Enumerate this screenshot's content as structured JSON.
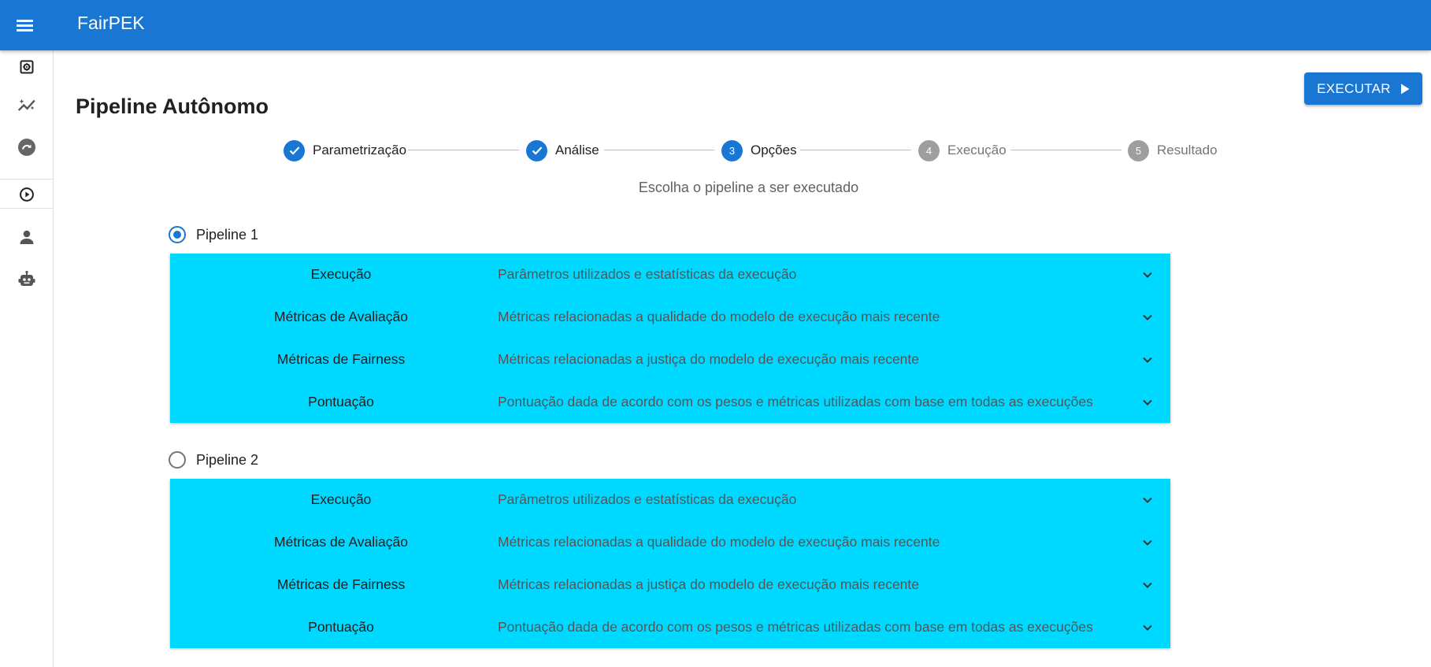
{
  "app": {
    "title": "FairPEK"
  },
  "page": {
    "title": "Pipeline Autônomo",
    "subtitle": "Escolha o pipeline a ser executado"
  },
  "actions": {
    "execute_label": "EXECUTAR"
  },
  "sidebar": {
    "items": [
      {
        "icon": "settings-box-icon"
      },
      {
        "icon": "auto-graph-icon"
      },
      {
        "icon": "refresh-circle-icon"
      },
      {
        "icon": "play-circle-icon"
      },
      {
        "icon": "person-icon"
      },
      {
        "icon": "robot-icon"
      }
    ]
  },
  "stepper": {
    "steps": [
      {
        "number": "1",
        "label": "Parametrização",
        "state": "completed"
      },
      {
        "number": "2",
        "label": "Análise",
        "state": "completed"
      },
      {
        "number": "3",
        "label": "Opções",
        "state": "active"
      },
      {
        "number": "4",
        "label": "Execução",
        "state": "inactive"
      },
      {
        "number": "5",
        "label": "Resultado",
        "state": "inactive"
      }
    ]
  },
  "pipelines": [
    {
      "label": "Pipeline 1",
      "selected": true,
      "sections": [
        {
          "name": "Execução",
          "description": "Parâmetros utilizados e estatísticas da execução"
        },
        {
          "name": "Métricas de Avaliação",
          "description": "Métricas relacionadas a qualidade do modelo de execução mais recente"
        },
        {
          "name": "Métricas de Fairness",
          "description": "Métricas relacionadas a justiça do modelo de execução mais recente"
        },
        {
          "name": "Pontuação",
          "description": "Pontuação dada de acordo com os pesos e métricas utilizadas com base em todas as execuções"
        }
      ]
    },
    {
      "label": "Pipeline 2",
      "selected": false,
      "sections": [
        {
          "name": "Execução",
          "description": "Parâmetros utilizados e estatísticas da execução"
        },
        {
          "name": "Métricas de Avaliação",
          "description": "Métricas relacionadas a qualidade do modelo de execução mais recente"
        },
        {
          "name": "Métricas de Fairness",
          "description": "Métricas relacionadas a justiça do modelo de execução mais recente"
        },
        {
          "name": "Pontuação",
          "description": "Pontuação dada de acordo com os pesos e métricas utilizadas com base em todas as execuções"
        }
      ]
    }
  ],
  "colors": {
    "primary": "#1976d2",
    "accordion_bg": "#00d9ff",
    "inactive_step": "#9e9e9e"
  }
}
